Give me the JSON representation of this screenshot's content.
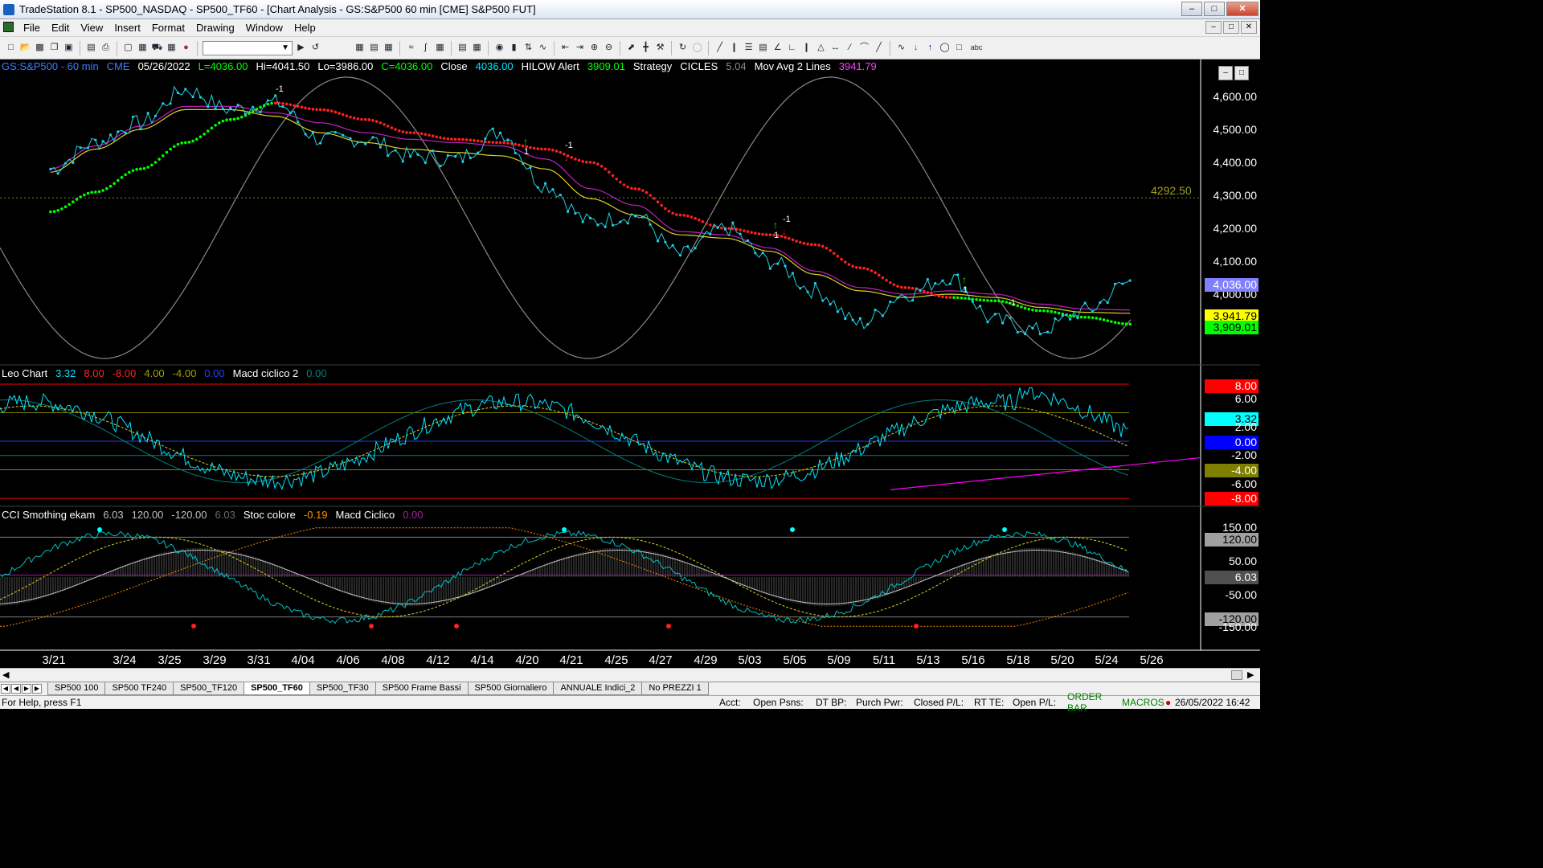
{
  "window": {
    "title": "TradeStation 8.1 - SP500_NASDAQ - SP500_TF60 - [Chart Analysis - GS:S&P500  60 min  [CME] S&P500 FUT]",
    "min_btn": "–",
    "max_btn": "□",
    "close_btn": "✕"
  },
  "menu": [
    "File",
    "Edit",
    "View",
    "Insert",
    "Format",
    "Drawing",
    "Window",
    "Help"
  ],
  "mdi_buttons": [
    "–",
    "□",
    "✕"
  ],
  "toolbar": {
    "combo_value": ""
  },
  "price_header": [
    {
      "text": "GS:S&P500 - 60 min",
      "color": "#3d7bff"
    },
    {
      "text": "CME",
      "color": "#3d7bff"
    },
    {
      "text": "05/26/2022",
      "color": "#ffffff"
    },
    {
      "text": "L=4036.00",
      "color": "#00ff00"
    },
    {
      "text": "Hi=4041.50",
      "color": "#ffffff"
    },
    {
      "text": "Lo=3986.00",
      "color": "#ffffff"
    },
    {
      "text": "C=4036.00",
      "color": "#00ff00"
    },
    {
      "text": "Close",
      "color": "#ffffff"
    },
    {
      "text": "4036.00",
      "color": "#00e5ff"
    },
    {
      "text": "HILOW Alert",
      "color": "#ffffff"
    },
    {
      "text": "3909.01",
      "color": "#00ff00"
    },
    {
      "text": "Strategy",
      "color": "#ffffff"
    },
    {
      "text": "CICLES",
      "color": "#ffffff"
    },
    {
      "text": "5.04",
      "color": "#8a8a8a"
    },
    {
      "text": "Mov Avg 2 Lines",
      "color": "#ffffff"
    },
    {
      "text": "3941.79",
      "color": "#ff3cff"
    }
  ],
  "leo_header": [
    {
      "text": "Leo Chart",
      "color": "#ffffff"
    },
    {
      "text": "3.32",
      "color": "#00e5ff"
    },
    {
      "text": "8.00",
      "color": "#ff2020"
    },
    {
      "text": "-8.00",
      "color": "#ff2020"
    },
    {
      "text": "4.00",
      "color": "#a0a000"
    },
    {
      "text": "-4.00",
      "color": "#a0a000"
    },
    {
      "text": "0.00",
      "color": "#2040ff"
    },
    {
      "text": "Macd ciclico 2",
      "color": "#ffffff"
    },
    {
      "text": "0.00",
      "color": "#008080"
    }
  ],
  "cci_header": [
    {
      "text": "CCI Smothing ekam",
      "color": "#ffffff"
    },
    {
      "text": "6.03",
      "color": "#c0c0c0"
    },
    {
      "text": "120.00",
      "color": "#c0c0c0"
    },
    {
      "text": "-120.00",
      "color": "#c0c0c0"
    },
    {
      "text": "6.03",
      "color": "#6a6a6a"
    },
    {
      "text": "Stoc colore",
      "color": "#ffffff"
    },
    {
      "text": "-0.19",
      "color": "#ff8c00"
    },
    {
      "text": "Macd Ciclico",
      "color": "#ffffff"
    },
    {
      "text": "0.00",
      "color": "#a020a0"
    }
  ],
  "price_axis": [
    "4,600.00",
    "4,500.00",
    "4,400.00",
    "4,300.00",
    "4,200.00",
    "4,100.00",
    "4,000.00"
  ],
  "price_tags": [
    {
      "text": "4,036.00",
      "bg": "#8080ff",
      "fg": "#ffffff"
    },
    {
      "text": "3,941.79",
      "bg": "#ffff00",
      "fg": "#000000"
    },
    {
      "text": "3,909.01",
      "bg": "#00ff00",
      "fg": "#000000"
    }
  ],
  "hline_label": "4292.50",
  "leo_axis": [
    {
      "text": "8.00",
      "bg": "#ff0000",
      "fg": "#ffffff"
    },
    {
      "text": "6.00",
      "bg": "",
      "fg": "#ffffff"
    },
    {
      "text": "3.32",
      "bg": "#00ffff",
      "fg": "#000000"
    },
    {
      "text": "2.00",
      "bg": "",
      "fg": "#ffffff"
    },
    {
      "text": "0.00",
      "bg": "#0000ff",
      "fg": "#ffffff"
    },
    {
      "text": "-2.00",
      "bg": "",
      "fg": "#ffffff"
    },
    {
      "text": "-4.00",
      "bg": "#808000",
      "fg": "#ffffff"
    },
    {
      "text": "-6.00",
      "bg": "",
      "fg": "#ffffff"
    },
    {
      "text": "-8.00",
      "bg": "#ff0000",
      "fg": "#ffffff"
    }
  ],
  "cci_axis": [
    {
      "text": "150.00",
      "bg": "",
      "fg": "#ffffff"
    },
    {
      "text": "120.00",
      "bg": "#a0a0a0",
      "fg": "#000000"
    },
    {
      "text": "50.00",
      "bg": "",
      "fg": "#ffffff"
    },
    {
      "text": "6.03",
      "bg": "#505050",
      "fg": "#ffffff"
    },
    {
      "text": "-50.00",
      "bg": "",
      "fg": "#ffffff"
    },
    {
      "text": "-120.00",
      "bg": "#a0a0a0",
      "fg": "#000000"
    },
    {
      "text": "-150.00",
      "bg": "",
      "fg": "#ffffff"
    }
  ],
  "dates": [
    "3/21",
    "3/24",
    "3/25",
    "3/29",
    "3/31",
    "4/04",
    "4/06",
    "4/08",
    "4/12",
    "4/14",
    "4/20",
    "4/21",
    "4/25",
    "4/27",
    "4/29",
    "5/03",
    "5/05",
    "5/09",
    "5/11",
    "5/13",
    "5/16",
    "5/18",
    "5/20",
    "5/24",
    "5/26"
  ],
  "signals": [
    {
      "text": "-1"
    },
    {
      "text": "1"
    },
    {
      "text": "-1"
    },
    {
      "text": "-1"
    },
    {
      "text": "1"
    },
    {
      "text": "1"
    },
    {
      "text": "-1"
    }
  ],
  "tabs": [
    "SP500 100",
    "SP500 TF240",
    "SP500_TF120",
    "SP500_TF60",
    "SP500_TF30",
    "SP500 Frame Bassi",
    "SP500 Giornaliero",
    "ANNUALE Indici_2",
    "No PREZZI 1"
  ],
  "active_tab": "SP500_TF60",
  "status": {
    "help": "For Help, press F1",
    "acct": "Acct:",
    "open_psns": "Open Psns:",
    "dt_bp": "DT BP:",
    "purch_pwr": "Purch Pwr:",
    "closed_pl": "Closed P/L:",
    "rt_te": "RT TE:",
    "open_pl": "Open P/L:",
    "order_bar": "ORDER BAR",
    "macros": "MACROS",
    "datetime": "26/05/2022 16:42"
  },
  "colors": {
    "price_dots": "#20d0e0",
    "red_avg": "#ff2020",
    "green_avg": "#00ff00",
    "magenta_avg": "#c020c0",
    "yellow_avg": "#e0d020",
    "cycle": "#8a8a8a"
  },
  "chart_data": {
    "type": "line",
    "title": "GS:S&P500 - 60 min",
    "x": [
      "3/21",
      "3/24",
      "3/25",
      "3/29",
      "3/31",
      "4/04",
      "4/06",
      "4/08",
      "4/12",
      "4/14",
      "4/20",
      "4/21",
      "4/25",
      "4/27",
      "4/29",
      "5/03",
      "5/05",
      "5/09",
      "5/11",
      "5/13",
      "5/16",
      "5/18",
      "5/20",
      "5/24",
      "5/26"
    ],
    "series": [
      {
        "name": "Close",
        "values": [
          4380,
          4460,
          4520,
          4620,
          4560,
          4580,
          4470,
          4470,
          4420,
          4410,
          4490,
          4330,
          4220,
          4240,
          4120,
          4200,
          4100,
          4010,
          3910,
          4000,
          4050,
          3920,
          3890,
          3950,
          4036
        ]
      },
      {
        "name": "Mov Avg 2 Lines",
        "values": [
          4370,
          4440,
          4500,
          4560,
          4560,
          4540,
          4490,
          4460,
          4440,
          4430,
          4420,
          4380,
          4290,
          4240,
          4180,
          4170,
          4130,
          4060,
          4010,
          3990,
          4000,
          3990,
          3960,
          3945,
          3942
        ]
      },
      {
        "name": "HILOW Alert",
        "values": [
          4250,
          4310,
          4380,
          4460,
          4530,
          4580,
          4560,
          4530,
          4490,
          4470,
          4460,
          4440,
          4400,
          4320,
          4240,
          4200,
          4180,
          4150,
          4080,
          4020,
          3990,
          3980,
          3950,
          3930,
          3909
        ]
      }
    ],
    "ylim": [
      3860,
      4660
    ]
  }
}
